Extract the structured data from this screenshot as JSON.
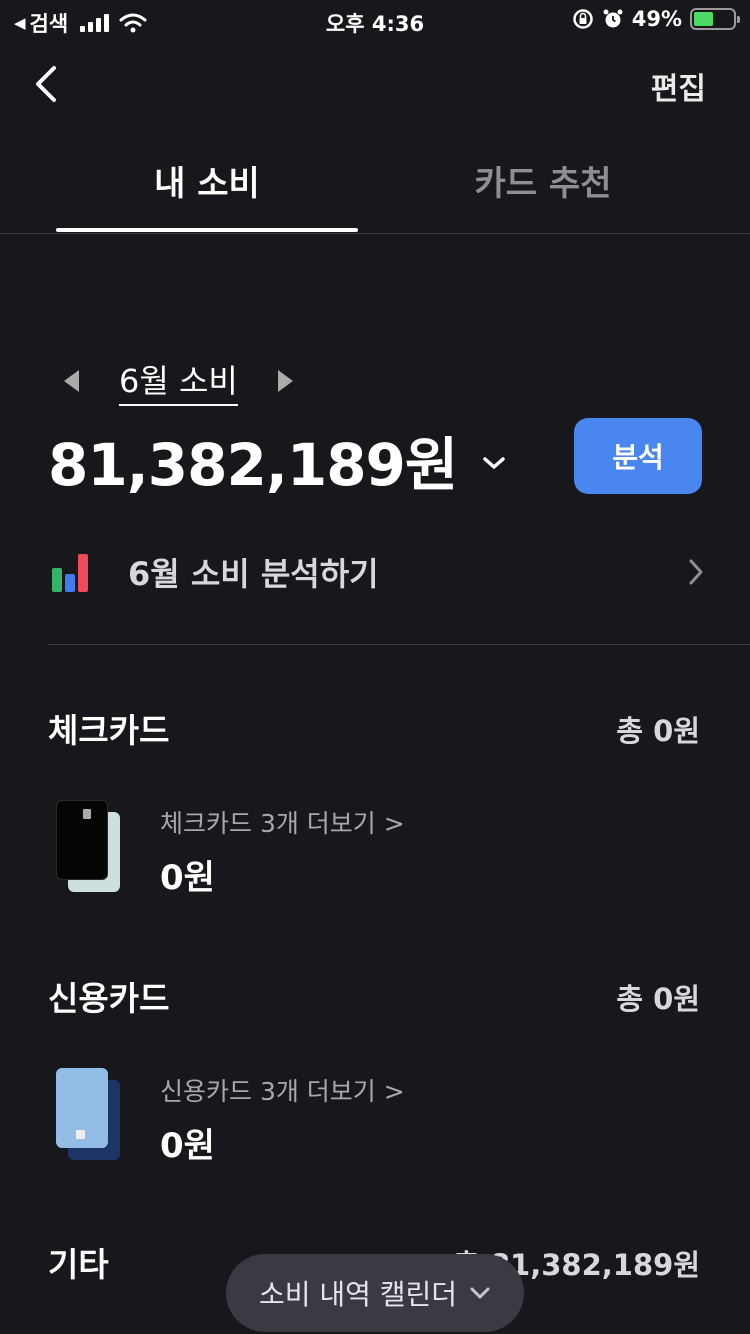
{
  "status_bar": {
    "back_app": "검색",
    "time": "오후 4:36",
    "battery": "49%",
    "battery_level": 0.49,
    "accent_color": "#4cd964"
  },
  "nav": {
    "back_icon": "chevron-left-icon",
    "edit_label": "편집"
  },
  "tabs": [
    {
      "label": "내 소비",
      "active": true
    },
    {
      "label": "카드 추천",
      "active": false
    }
  ],
  "summary": {
    "month_label": "6월 소비",
    "total": "81,382,189원",
    "analyze_button": "분석",
    "analyze_button_color": "#4a86f0",
    "analysis_link": "6월 소비 분석하기",
    "chart_icon_colors": [
      "#34b36b",
      "#3f7cf0",
      "#ef4b5b"
    ]
  },
  "sections": {
    "check": {
      "title": "체크카드",
      "total": "총 0원",
      "more": "체크카드 3개 더보기 >",
      "amount": "0원"
    },
    "credit": {
      "title": "신용카드",
      "total": "총 0원",
      "more": "신용카드 3개 더보기 >",
      "amount": "0원"
    },
    "other": {
      "title": "기타",
      "total": "총 81,382,189원"
    }
  },
  "floating_button": {
    "label": "소비 내역 캘린더"
  }
}
